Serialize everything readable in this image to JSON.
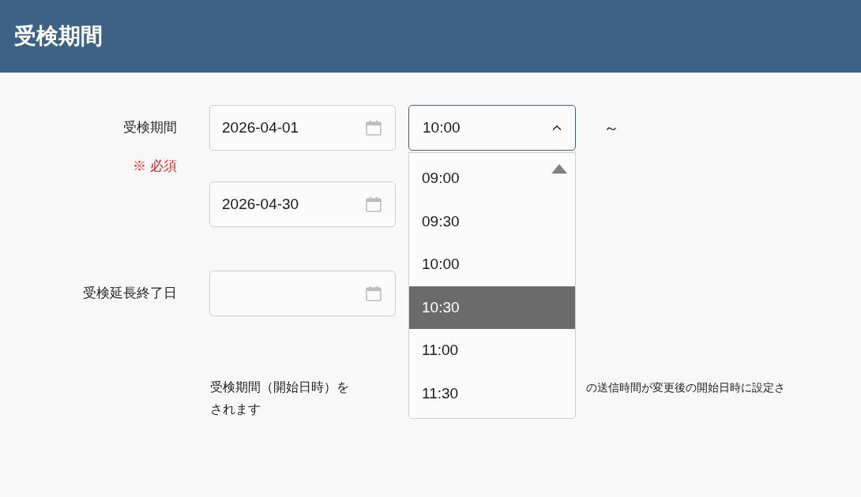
{
  "header": {
    "title": "受検期間"
  },
  "period": {
    "label": "受検期間",
    "required": "※ 必須",
    "start_date": "2026-04-01",
    "start_time": "10:00",
    "separator": "～",
    "end_date": "2026-04-30",
    "time_select": {
      "expanded": true,
      "options": [
        {
          "label": "09:00",
          "selected": false
        },
        {
          "label": "09:30",
          "selected": false
        },
        {
          "label": "10:00",
          "selected": false
        },
        {
          "label": "10:30",
          "selected": true
        },
        {
          "label": "11:00",
          "selected": false
        },
        {
          "label": "11:30",
          "selected": false
        }
      ]
    }
  },
  "extension": {
    "label": "受検延長終了日"
  },
  "note": {
    "line_1_start": "受検期間（開始日時）を",
    "line_1_end": "の送信時間が変更後の開始日時に設定さ",
    "line_2": "されます"
  }
}
